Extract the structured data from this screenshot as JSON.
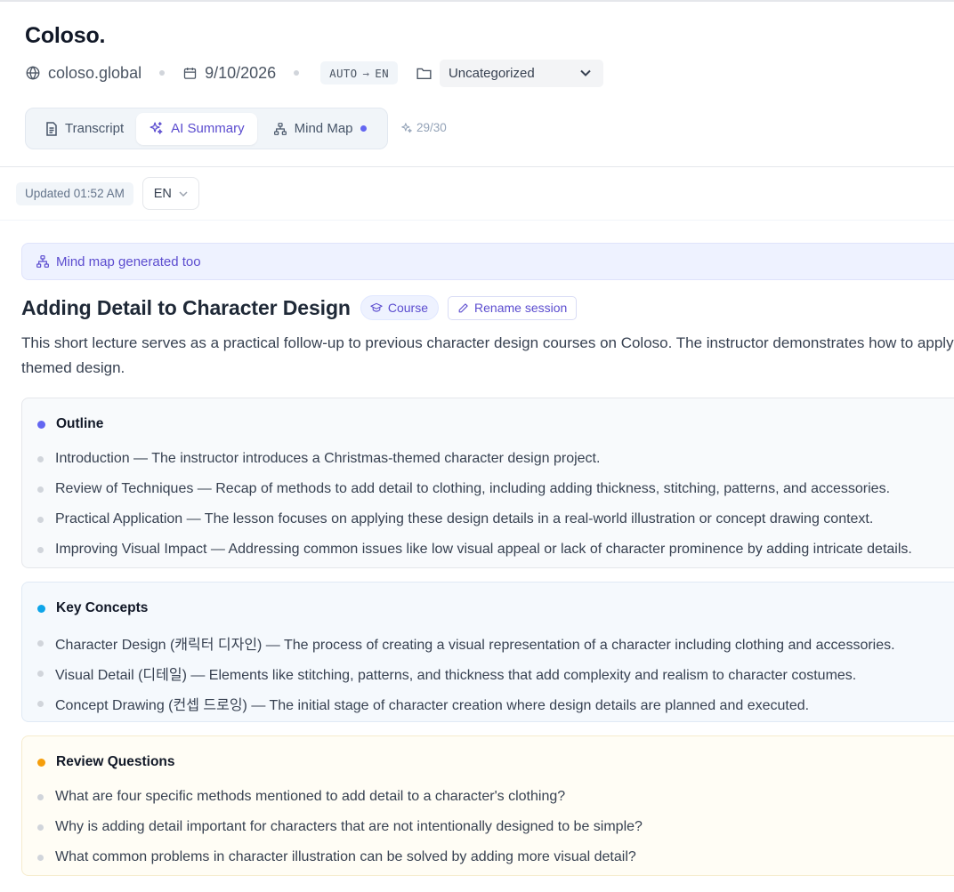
{
  "app": {
    "title": "Coloso."
  },
  "meta": {
    "site": "coloso.global",
    "date": "9/10/2026",
    "lang_from": "AUTO",
    "lang_to": "EN",
    "folder": "Uncategorized"
  },
  "tabs": [
    {
      "label": "Transcript",
      "icon": "document-icon",
      "active": false
    },
    {
      "label": "AI Summary",
      "icon": "sparkles-icon",
      "active": true
    },
    {
      "label": "Mind Map",
      "icon": "sitemap-icon",
      "active": false,
      "has_dot": true
    }
  ],
  "credits": "29/30",
  "toolbar": {
    "updated": "Updated 01:52 AM",
    "language": "EN"
  },
  "notice": "Mind map generated too",
  "doc": {
    "title": "Adding Detail to Character Design",
    "badge": "Course",
    "rename_label": "Rename session",
    "summary_line1": "This short lecture serves as a practical follow-up to previous character design courses on Coloso. The instructor demonstrates how to apply sp",
    "summary_line2": "themed design."
  },
  "sections": {
    "outline": {
      "title": "Outline",
      "accent": "#6366f1",
      "items": [
        "Introduction — The instructor introduces a Christmas-themed character design project.",
        "Review of Techniques — Recap of methods to add detail to clothing, including adding thickness, stitching, patterns, and accessories.",
        "Practical Application — The lesson focuses on applying these design details in a real-world illustration or concept drawing context.",
        "Improving Visual Impact — Addressing common issues like low visual appeal or lack of character prominence by adding intricate details."
      ]
    },
    "concepts": {
      "title": "Key Concepts",
      "accent": "#0ea5e9",
      "items": [
        "Character Design (캐릭터 디자인) — The process of creating a visual representation of a character including clothing and accessories.",
        "Visual Detail (디테일) — Elements like stitching, patterns, and thickness that add complexity and realism to character costumes.",
        "Concept Drawing (컨셉 드로잉) — The initial stage of character creation where design details are planned and executed."
      ]
    },
    "questions": {
      "title": "Review Questions",
      "accent": "#f59e0b",
      "items": [
        "What are four specific methods mentioned to add detail to a character's clothing?",
        "Why is adding detail important for characters that are not intentionally designed to be simple?",
        "What common problems in character illustration can be solved by adding more visual detail?"
      ]
    }
  }
}
